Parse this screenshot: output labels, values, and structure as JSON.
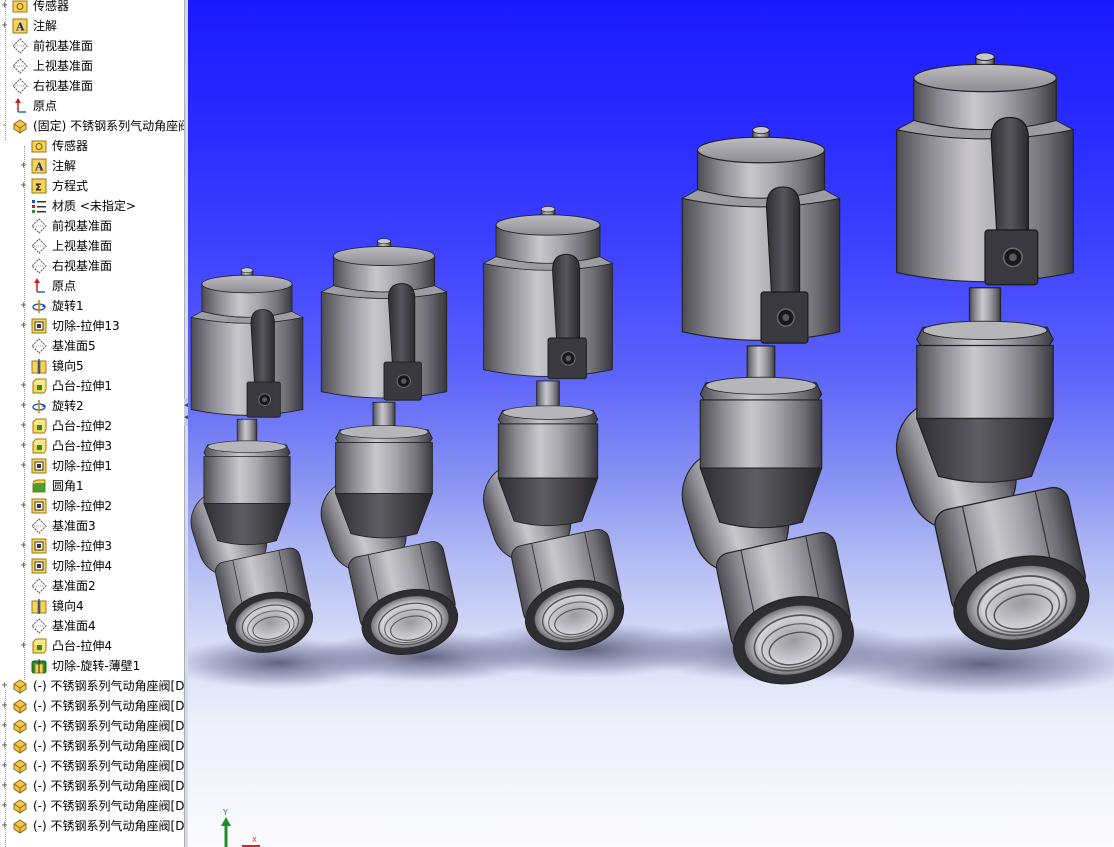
{
  "feature_tree": {
    "items": [
      {
        "label": "传感器",
        "icon": "sensor-icon",
        "expander": "+"
      },
      {
        "label": "注解",
        "icon": "annotation-icon",
        "expander": "+"
      },
      {
        "label": "前视基准面",
        "icon": "plane-icon",
        "expander": ""
      },
      {
        "label": "上视基准面",
        "icon": "plane-icon",
        "expander": ""
      },
      {
        "label": "右视基准面",
        "icon": "plane-icon",
        "expander": ""
      },
      {
        "label": "原点",
        "icon": "origin-icon",
        "expander": ""
      },
      {
        "label": "(固定) 不锈钢系列气动角座阀",
        "icon": "part-icon",
        "expander": "-"
      },
      {
        "label": "传感器",
        "icon": "sensor-icon",
        "expander": ""
      },
      {
        "label": "注解",
        "icon": "annotation-icon",
        "expander": "+"
      },
      {
        "label": "方程式",
        "icon": "equation-icon",
        "expander": "+"
      },
      {
        "label": "材质 <未指定>",
        "icon": "material-icon",
        "expander": ""
      },
      {
        "label": "前视基准面",
        "icon": "plane-icon",
        "expander": ""
      },
      {
        "label": "上视基准面",
        "icon": "plane-icon",
        "expander": ""
      },
      {
        "label": "右视基准面",
        "icon": "plane-icon",
        "expander": ""
      },
      {
        "label": "原点",
        "icon": "origin-icon",
        "expander": ""
      },
      {
        "label": "旋转1",
        "icon": "revolve-icon",
        "expander": "+"
      },
      {
        "label": "切除-拉伸13",
        "icon": "cut-extrude-icon",
        "expander": "+"
      },
      {
        "label": "基准面5",
        "icon": "plane-icon",
        "expander": ""
      },
      {
        "label": "镜向5",
        "icon": "mirror-icon",
        "expander": ""
      },
      {
        "label": "凸台-拉伸1",
        "icon": "boss-extrude-icon",
        "expander": "+"
      },
      {
        "label": "旋转2",
        "icon": "revolve-icon",
        "expander": "+"
      },
      {
        "label": "凸台-拉伸2",
        "icon": "boss-extrude-icon",
        "expander": "+"
      },
      {
        "label": "凸台-拉伸3",
        "icon": "boss-extrude-icon",
        "expander": "+"
      },
      {
        "label": "切除-拉伸1",
        "icon": "cut-extrude-icon",
        "expander": "+"
      },
      {
        "label": "圆角1",
        "icon": "fillet-icon",
        "expander": ""
      },
      {
        "label": "切除-拉伸2",
        "icon": "cut-extrude-icon",
        "expander": "+"
      },
      {
        "label": "基准面3",
        "icon": "plane-icon",
        "expander": ""
      },
      {
        "label": "切除-拉伸3",
        "icon": "cut-extrude-icon",
        "expander": "+"
      },
      {
        "label": "切除-拉伸4",
        "icon": "cut-extrude-icon",
        "expander": "+"
      },
      {
        "label": "基准面2",
        "icon": "plane-icon",
        "expander": ""
      },
      {
        "label": "镜向4",
        "icon": "mirror-icon",
        "expander": ""
      },
      {
        "label": "基准面4",
        "icon": "plane-icon",
        "expander": ""
      },
      {
        "label": "凸台-拉伸4",
        "icon": "boss-extrude-icon",
        "expander": "+"
      },
      {
        "label": "切除-旋转-薄壁1",
        "icon": "cut-revolve-thin-icon",
        "expander": ""
      },
      {
        "label": "(-) 不锈钢系列气动角座阀[D",
        "icon": "part-icon",
        "expander": "+"
      },
      {
        "label": "(-) 不锈钢系列气动角座阀[D",
        "icon": "part-icon",
        "expander": "+"
      },
      {
        "label": "(-) 不锈钢系列气动角座阀[D",
        "icon": "part-icon",
        "expander": "+"
      },
      {
        "label": "(-) 不锈钢系列气动角座阀[D",
        "icon": "part-icon",
        "expander": "+"
      },
      {
        "label": "(-) 不锈钢系列气动角座阀[D",
        "icon": "part-icon",
        "expander": "+"
      },
      {
        "label": "(-) 不锈钢系列气动角座阀[D",
        "icon": "part-icon",
        "expander": "+"
      },
      {
        "label": "(-) 不锈钢系列气动角座阀[D",
        "icon": "part-icon",
        "expander": "+"
      },
      {
        "label": "(-) 不锈钢系列气动角座阀[D",
        "icon": "part-icon",
        "expander": "+"
      }
    ]
  },
  "viewport": {
    "background_top": "#1a1aff",
    "background_bottom": "#fbfbfe",
    "model_color": "#8a8a8e",
    "valves": [
      {
        "name": "valve-size-1"
      },
      {
        "name": "valve-size-2"
      },
      {
        "name": "valve-size-3"
      },
      {
        "name": "valve-size-4"
      },
      {
        "name": "valve-size-5"
      }
    ],
    "triad": {
      "axis_y": "Y",
      "axis_x": "X"
    }
  }
}
